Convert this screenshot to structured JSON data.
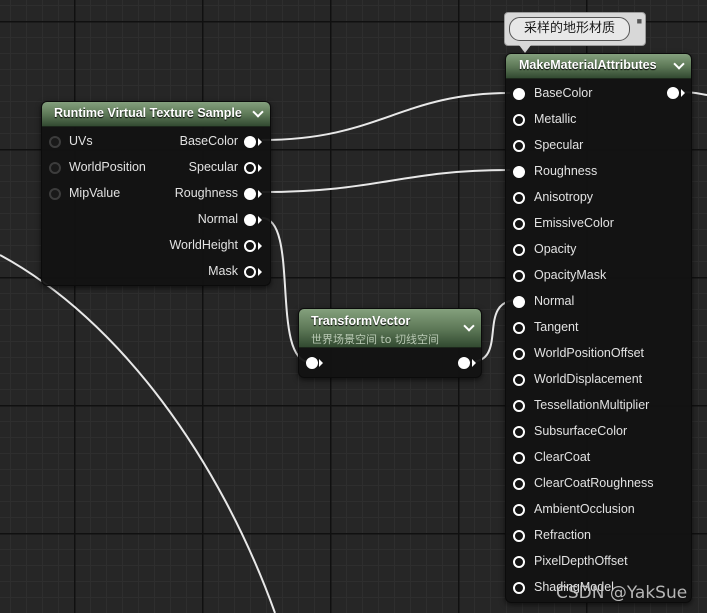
{
  "comment": {
    "text": "采样的地形材质"
  },
  "rvt_node": {
    "title": "Runtime Virtual Texture Sample",
    "inputs": [
      {
        "label": "UVs"
      },
      {
        "label": "WorldPosition"
      },
      {
        "label": "MipValue"
      }
    ],
    "outputs": [
      {
        "label": "BaseColor",
        "connected": true
      },
      {
        "label": "Specular",
        "connected": false
      },
      {
        "label": "Roughness",
        "connected": true
      },
      {
        "label": "Normal",
        "connected": true
      },
      {
        "label": "WorldHeight",
        "connected": false
      },
      {
        "label": "Mask",
        "connected": false
      }
    ]
  },
  "transform_node": {
    "title": "TransformVector",
    "subtitle": "世界场景空间 to 切线空间"
  },
  "mma_node": {
    "title": "MakeMaterialAttributes",
    "inputs": [
      {
        "label": "BaseColor",
        "connected": true
      },
      {
        "label": "Metallic",
        "connected": false
      },
      {
        "label": "Specular",
        "connected": false
      },
      {
        "label": "Roughness",
        "connected": true
      },
      {
        "label": "Anisotropy",
        "connected": false
      },
      {
        "label": "EmissiveColor",
        "connected": false
      },
      {
        "label": "Opacity",
        "connected": false
      },
      {
        "label": "OpacityMask",
        "connected": false
      },
      {
        "label": "Normal",
        "connected": true
      },
      {
        "label": "Tangent",
        "connected": false
      },
      {
        "label": "WorldPositionOffset",
        "connected": false
      },
      {
        "label": "WorldDisplacement",
        "connected": false
      },
      {
        "label": "TessellationMultiplier",
        "connected": false
      },
      {
        "label": "SubsurfaceColor",
        "connected": false
      },
      {
        "label": "ClearCoat",
        "connected": false
      },
      {
        "label": "ClearCoatRoughness",
        "connected": false
      },
      {
        "label": "AmbientOcclusion",
        "connected": false
      },
      {
        "label": "Refraction",
        "connected": false
      },
      {
        "label": "PixelDepthOffset",
        "connected": false
      },
      {
        "label": "ShadingModel",
        "connected": false
      }
    ]
  },
  "watermark": "CSDN @YakSue",
  "colors": {
    "header_green": "#5b7655",
    "wire": "#e8e8e8",
    "grid_bg": "#262626"
  }
}
